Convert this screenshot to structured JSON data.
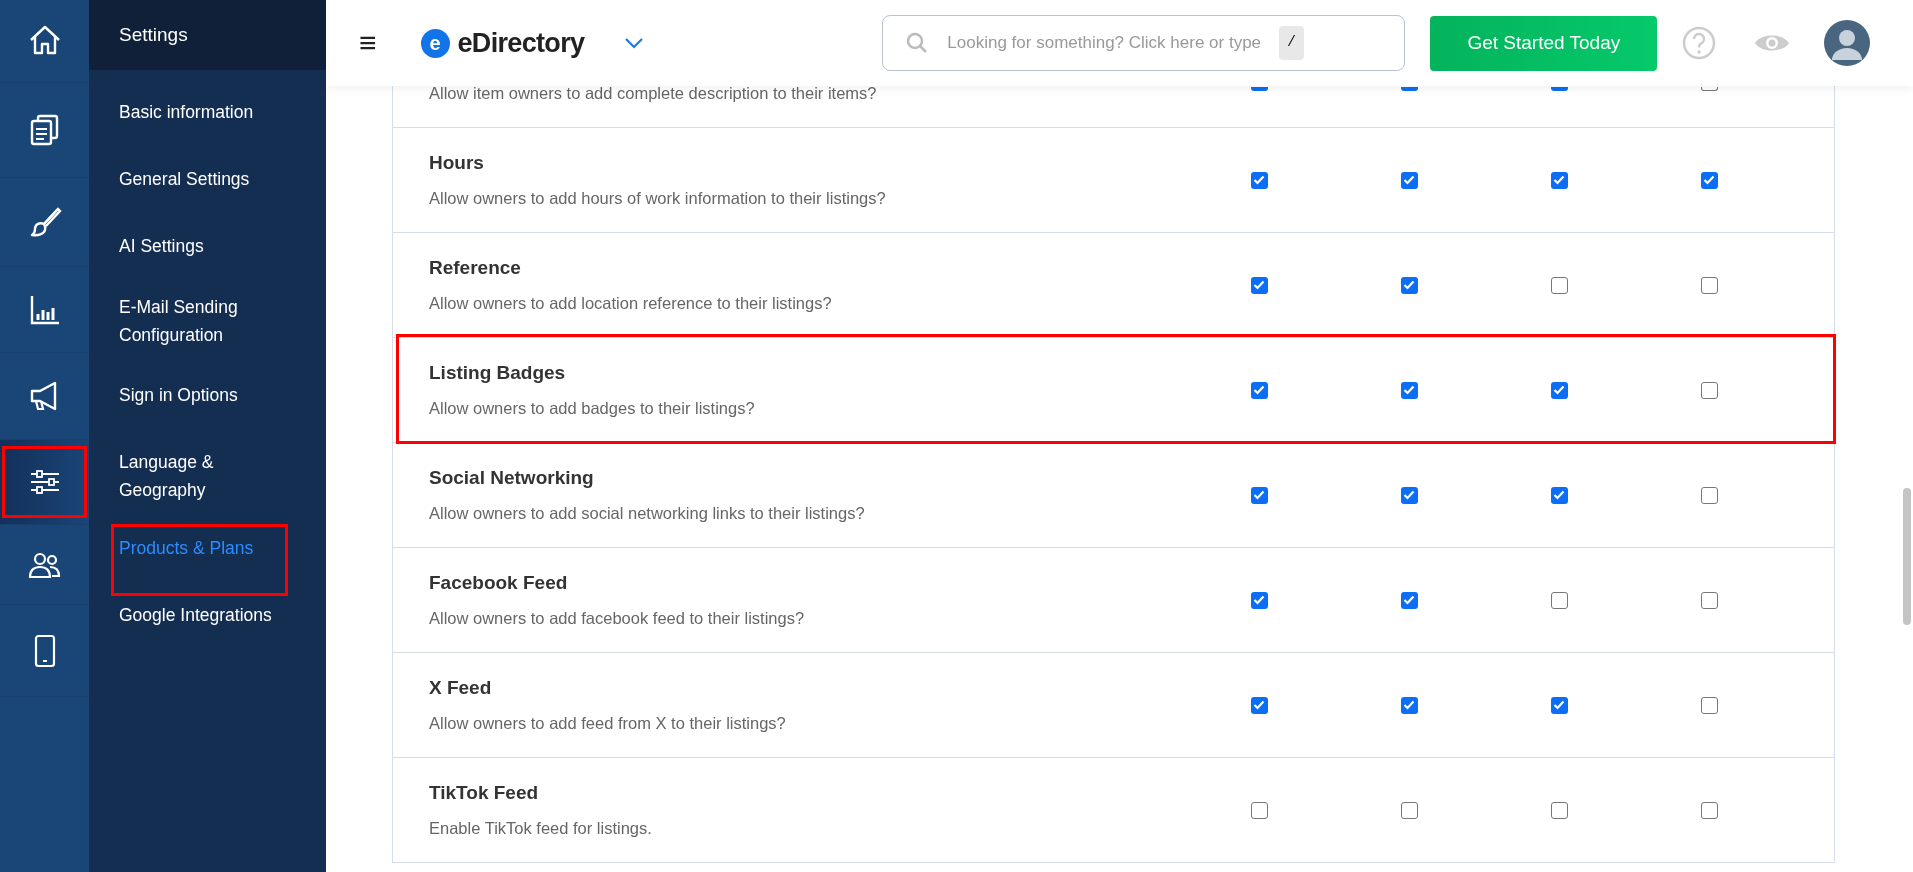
{
  "rail": [
    {
      "kind": "home",
      "selected": false,
      "annotated": false
    },
    {
      "kind": "documents",
      "selected": false,
      "annotated": false
    },
    {
      "kind": "brush",
      "selected": false,
      "annotated": false
    },
    {
      "kind": "chart",
      "selected": false,
      "annotated": false
    },
    {
      "kind": "megaphone",
      "selected": false,
      "annotated": false
    },
    {
      "kind": "sliders",
      "selected": true,
      "annotated": true
    },
    {
      "kind": "users",
      "selected": false,
      "annotated": false
    },
    {
      "kind": "phone",
      "selected": false,
      "annotated": false
    }
  ],
  "submenu": {
    "title": "Settings",
    "items": [
      {
        "label": "Basic information",
        "selected": false,
        "annotated": false
      },
      {
        "label": "General Settings",
        "selected": false,
        "annotated": false
      },
      {
        "label": "AI Settings",
        "selected": false,
        "annotated": false
      },
      {
        "label": "E-Mail Sending Configuration",
        "selected": false,
        "annotated": false
      },
      {
        "label": "Sign in Options",
        "selected": false,
        "annotated": false
      },
      {
        "label": "Language & Geography",
        "selected": false,
        "annotated": false
      },
      {
        "label": "Products & Plans",
        "selected": true,
        "annotated": true
      },
      {
        "label": "Google Integrations",
        "selected": false,
        "annotated": false
      }
    ]
  },
  "header": {
    "menu_glyph": "≡",
    "logo_letter": "e",
    "brand": "eDirectory",
    "search": {
      "placeholder": "Looking for something? Click here or type",
      "shortcut": "/"
    },
    "cta": "Get Started Today"
  },
  "rows": [
    {
      "title": "",
      "description": "Allow item owners to add complete description to their items?",
      "checks": [
        true,
        true,
        true,
        false
      ],
      "annotated": false
    },
    {
      "title": "Hours",
      "description": "Allow owners to add hours of work information to their listings?",
      "checks": [
        true,
        true,
        true,
        true
      ],
      "annotated": false
    },
    {
      "title": "Reference",
      "description": "Allow owners to add location reference to their listings?",
      "checks": [
        true,
        true,
        false,
        false
      ],
      "annotated": false
    },
    {
      "title": "Listing Badges",
      "description": "Allow owners to add badges to their listings?",
      "checks": [
        true,
        true,
        true,
        false
      ],
      "annotated": true
    },
    {
      "title": "Social Networking",
      "description": "Allow owners to add social networking links to their listings?",
      "checks": [
        true,
        true,
        true,
        false
      ],
      "annotated": false
    },
    {
      "title": "Facebook Feed",
      "description": "Allow owners to add facebook feed to their listings?",
      "checks": [
        true,
        true,
        false,
        false
      ],
      "annotated": false
    },
    {
      "title": "X Feed",
      "description": "Allow owners to add feed from X to their listings?",
      "checks": [
        true,
        true,
        true,
        false
      ],
      "annotated": false
    },
    {
      "title": "TikTok Feed",
      "description": "Enable TikTok feed for listings.",
      "checks": [
        false,
        false,
        false,
        false
      ],
      "annotated": false
    }
  ]
}
